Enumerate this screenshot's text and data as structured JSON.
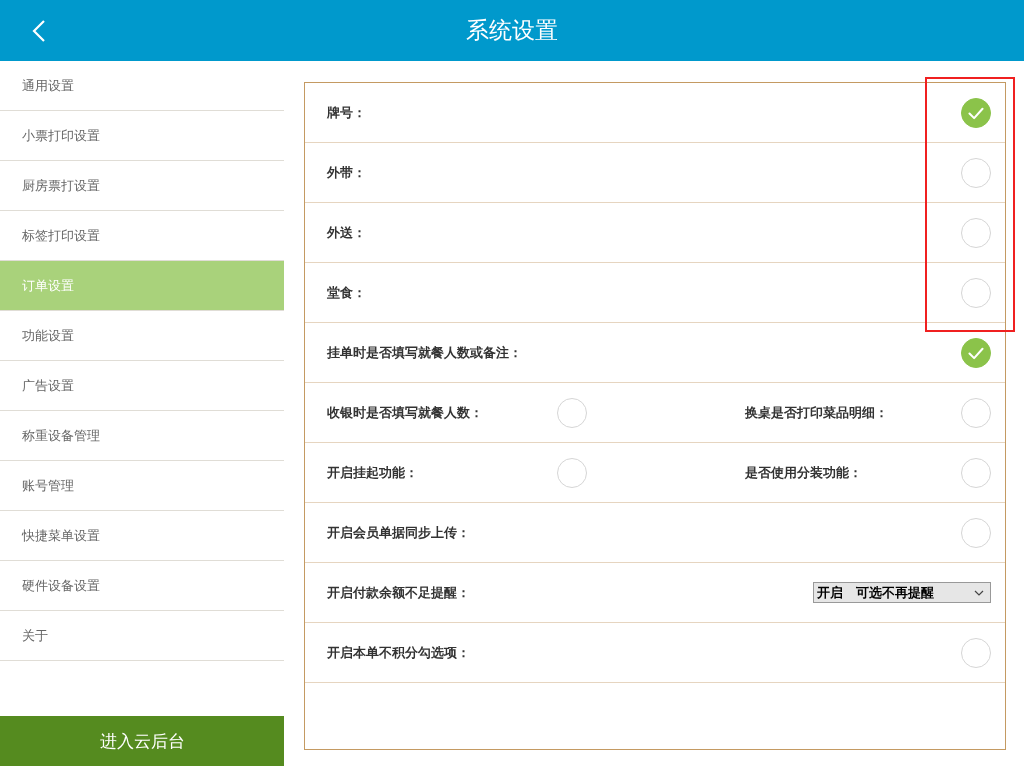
{
  "header": {
    "title": "系统设置"
  },
  "sidebar": {
    "items": [
      {
        "label": "通用设置",
        "selected": false
      },
      {
        "label": "小票打印设置",
        "selected": false
      },
      {
        "label": "厨房票打设置",
        "selected": false
      },
      {
        "label": "标签打印设置",
        "selected": false
      },
      {
        "label": "订单设置",
        "selected": true
      },
      {
        "label": "功能设置",
        "selected": false
      },
      {
        "label": "广告设置",
        "selected": false
      },
      {
        "label": "称重设备管理",
        "selected": false
      },
      {
        "label": "账号管理",
        "selected": false
      },
      {
        "label": "快捷菜单设置",
        "selected": false
      },
      {
        "label": "硬件设备设置",
        "selected": false
      },
      {
        "label": "关于",
        "selected": false
      }
    ],
    "footer_button": "进入云后台"
  },
  "settings": [
    {
      "kind": "toggle",
      "label": "牌号：",
      "checked": true
    },
    {
      "kind": "toggle",
      "label": "外带：",
      "checked": false
    },
    {
      "kind": "toggle",
      "label": "外送：",
      "checked": false
    },
    {
      "kind": "toggle",
      "label": "堂食：",
      "checked": false
    },
    {
      "kind": "toggle",
      "label": "挂单时是否填写就餐人数或备注：",
      "checked": true
    },
    {
      "kind": "pair",
      "items": [
        {
          "label": "收银时是否填写就餐人数：",
          "checked": false
        },
        {
          "label": "换桌是否打印菜品明细：",
          "checked": false
        }
      ]
    },
    {
      "kind": "pair",
      "items": [
        {
          "label": "开启挂起功能：",
          "checked": false
        },
        {
          "label": "是否使用分装功能：",
          "checked": false
        }
      ]
    },
    {
      "kind": "toggle",
      "label": "开启会员单据同步上传：",
      "checked": false
    },
    {
      "kind": "select",
      "label": "开启付款余额不足提醒：",
      "value": "开启　可选不再提醒"
    },
    {
      "kind": "toggle",
      "label": "开启本单不积分勾选项：",
      "checked": false
    }
  ]
}
